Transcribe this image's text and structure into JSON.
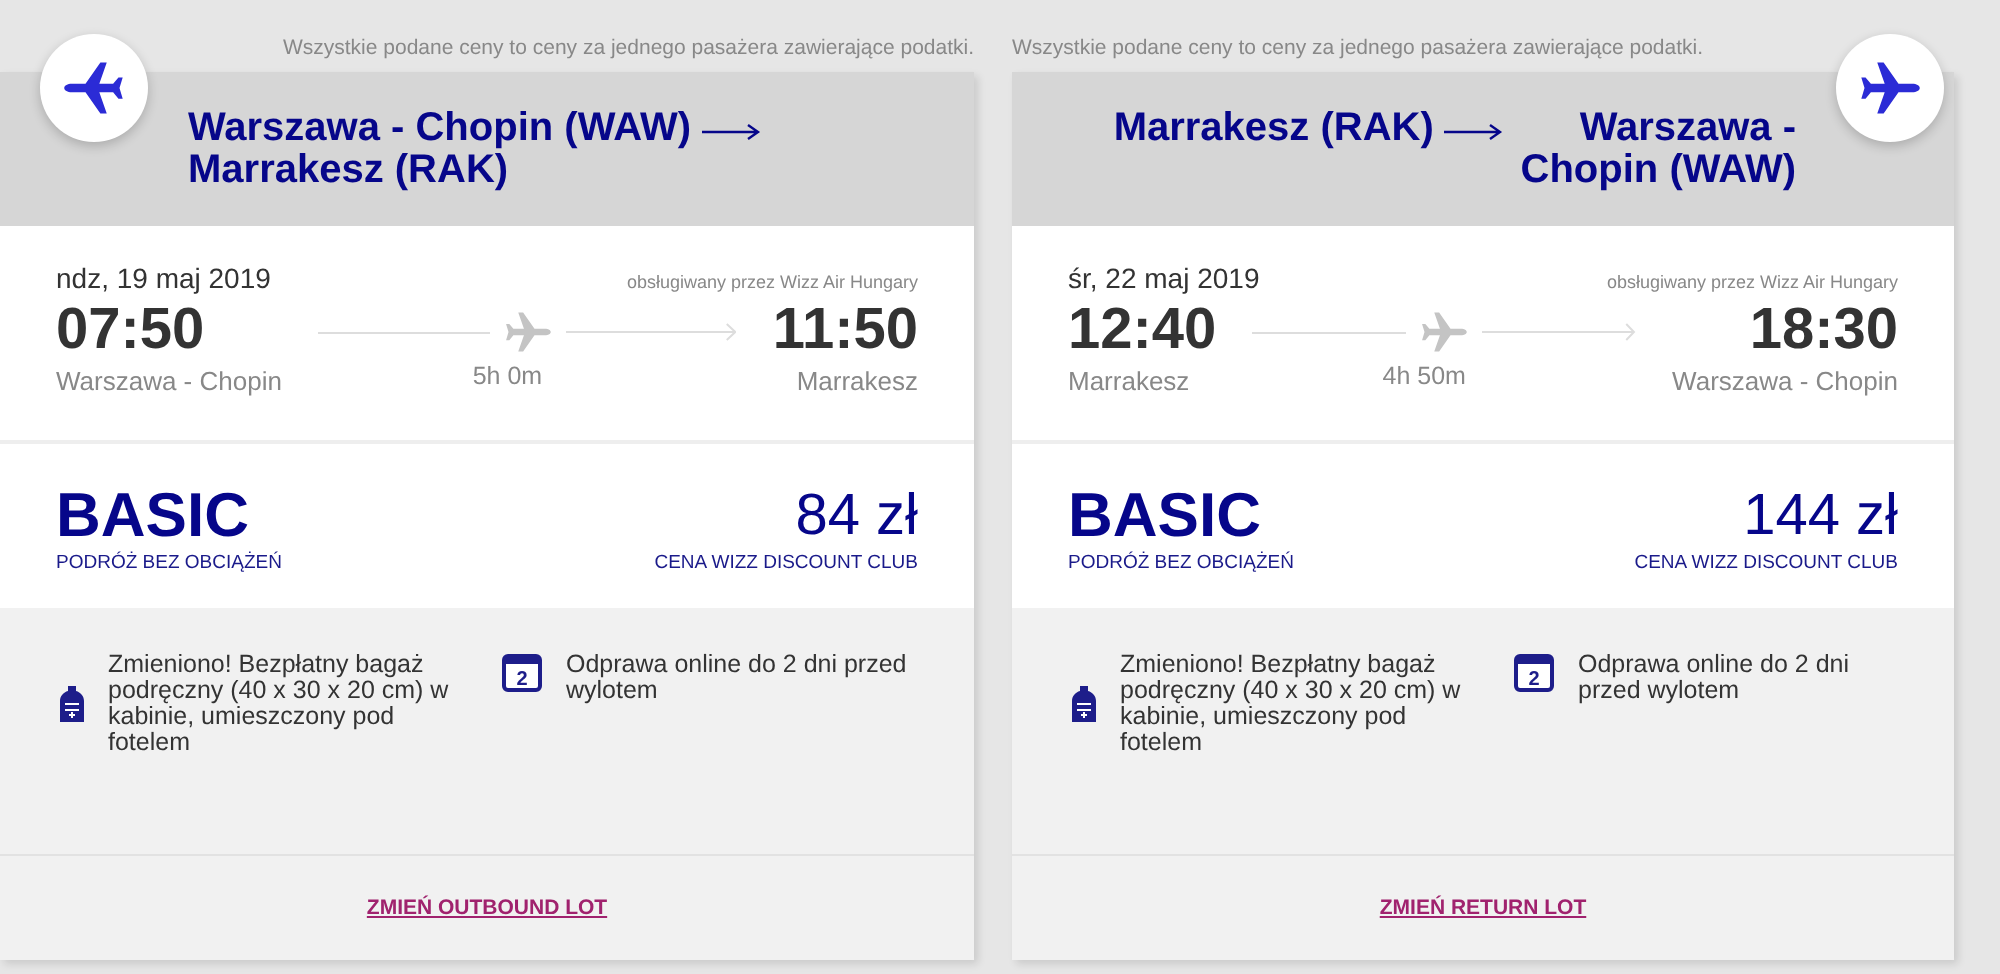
{
  "cards": [
    {
      "kind": "outbound",
      "notice": "Wszystkie podane ceny to ceny za jednego pasażera zawierające podatki.",
      "route": {
        "from": "Warszawa - Chopin (WAW)",
        "to": "Marrakesz (RAK)"
      },
      "date": "ndz, 19 maj 2019",
      "operated_by": "obsługiwany przez Wizz Air Hungary",
      "departure": {
        "time": "07:50",
        "city": "Warszawa - Chopin"
      },
      "duration": "5h 0m",
      "arrival": {
        "time": "11:50",
        "city": "Marrakesz"
      },
      "fare": {
        "name": "BASIC",
        "subtitle": "PODRÓŻ BEZ OBCIĄŻEŃ",
        "price": "84 zł",
        "price_note": "CENA WIZZ DISCOUNT CLUB"
      },
      "features": [
        {
          "kind": "baggage",
          "text": "Zmieniono! Bezpłatny bagaż podręczny (40 x 30 x 20 cm) w kabinie, umieszczony pod fotelem"
        },
        {
          "kind": "checkin",
          "icon_text": "2",
          "text": "Odprawa online do 2 dni przed wylotem"
        }
      ],
      "change_link": "ZMIEŃ OUTBOUND LOT"
    },
    {
      "kind": "return",
      "notice": "Wszystkie podane ceny to ceny za jednego pasażera zawierające podatki.",
      "route": {
        "from": "Marrakesz (RAK)",
        "to": "Warszawa - Chopin (WAW)"
      },
      "date": "śr, 22 maj 2019",
      "operated_by": "obsługiwany przez Wizz Air Hungary",
      "departure": {
        "time": "12:40",
        "city": "Marrakesz"
      },
      "duration": "4h 50m",
      "arrival": {
        "time": "18:30",
        "city": "Warszawa - Chopin"
      },
      "fare": {
        "name": "BASIC",
        "subtitle": "PODRÓŻ BEZ OBCIĄŻEŃ",
        "price": "144 zł",
        "price_note": "CENA WIZZ DISCOUNT CLUB"
      },
      "features": [
        {
          "kind": "baggage",
          "text": "Zmieniono! Bezpłatny bagaż podręczny (40 x 30 x 20 cm) w kabinie, umieszczony pod fotelem"
        },
        {
          "kind": "checkin",
          "icon_text": "2",
          "text": "Odprawa online do 2 dni przed wylotem"
        }
      ],
      "change_link": "ZMIEŃ RETURN LOT"
    }
  ]
}
